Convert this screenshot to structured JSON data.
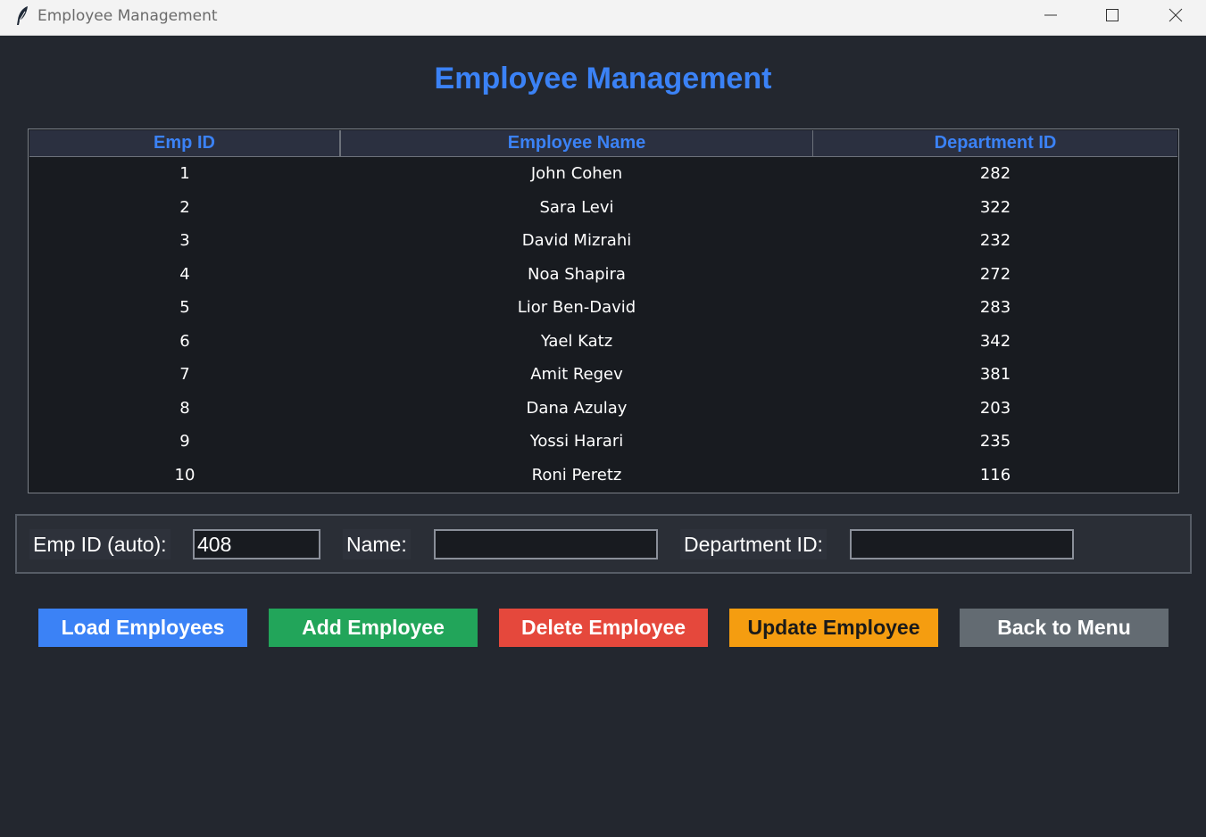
{
  "window": {
    "title": "Employee Management",
    "icon": "feather-icon",
    "controls": [
      "minimize-icon",
      "maximize-icon",
      "close-icon"
    ]
  },
  "page": {
    "title": "Employee Management"
  },
  "table": {
    "columns": [
      "Emp ID",
      "Employee Name",
      "Department ID"
    ],
    "rows": [
      [
        "1",
        "John Cohen",
        "282"
      ],
      [
        "2",
        "Sara Levi",
        "322"
      ],
      [
        "3",
        "David Mizrahi",
        "232"
      ],
      [
        "4",
        "Noa Shapira",
        "272"
      ],
      [
        "5",
        "Lior Ben-David",
        "283"
      ],
      [
        "6",
        "Yael Katz",
        "342"
      ],
      [
        "7",
        "Amit Regev",
        "381"
      ],
      [
        "8",
        "Dana Azulay",
        "203"
      ],
      [
        "9",
        "Yossi Harari",
        "235"
      ],
      [
        "10",
        "Roni Peretz",
        "116"
      ]
    ]
  },
  "form": {
    "emp_id_label": "Emp ID (auto):",
    "emp_id_value": "408",
    "name_label": "Name:",
    "name_value": "",
    "dept_label": "Department ID:",
    "dept_value": ""
  },
  "buttons": {
    "load": "Load Employees",
    "add": "Add Employee",
    "delete": "Delete Employee",
    "update": "Update Employee",
    "back": "Back to Menu"
  },
  "colors": {
    "accent": "#3b82f6",
    "add": "#22a55a",
    "delete": "#e5483c",
    "update": "#f59d10",
    "back": "#636b72",
    "background": "#23272f"
  }
}
